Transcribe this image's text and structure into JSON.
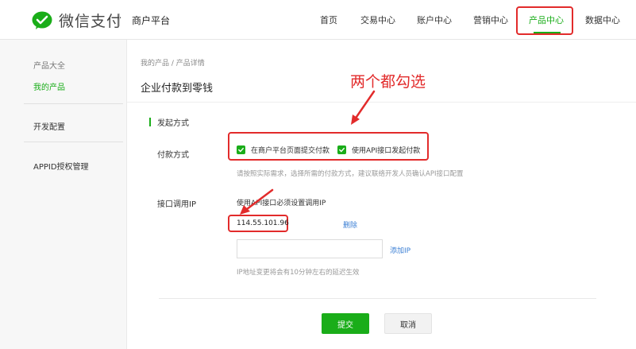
{
  "header": {
    "logo_text": "微信支付",
    "platform": "商户平台",
    "nav": [
      "首页",
      "交易中心",
      "账户中心",
      "营销中心",
      "产品中心",
      "数据中心"
    ],
    "active_nav": "产品中心"
  },
  "sidebar": {
    "group_label": "产品大全",
    "items": [
      {
        "label": "我的产品",
        "active": true
      },
      {
        "label": "开发配置",
        "active": false
      },
      {
        "label": "APPID授权管理",
        "active": false
      }
    ]
  },
  "main": {
    "breadcrumb": "我的产品 / 产品详情",
    "title": "企业付款到零钱",
    "section_title": "发起方式",
    "payment_label": "付款方式",
    "options": [
      {
        "label": "在商户平台页面提交付款",
        "checked": true
      },
      {
        "label": "使用API接口发起付款",
        "checked": true
      }
    ],
    "payment_hint": "请按照实际需求，选择所需的付款方式，建议联络开发人员确认API接口配置",
    "ip_label": "接口调用IP",
    "ip_desc": "使用API接口必须设置调用IP",
    "ip_value": "114.55.101.96",
    "delete_label": "删除",
    "add_ip_label": "添加IP",
    "ip_hint": "IP地址变更将会有10分钟左右的延迟生效",
    "submit_label": "提交",
    "cancel_label": "取消"
  },
  "annotation": {
    "text": "两个都勾选",
    "color": "#e22b2b"
  },
  "colors": {
    "brand_green": "#1aad19",
    "highlight_red": "#e22b2b",
    "link_blue": "#3b7fd4"
  },
  "icons": [
    "wechat-pay-logo-icon",
    "checkbox-checked-icon"
  ]
}
